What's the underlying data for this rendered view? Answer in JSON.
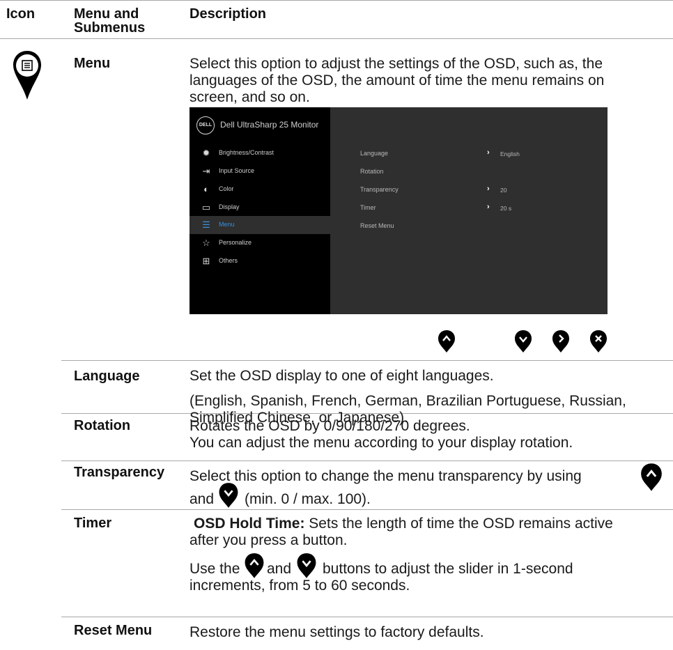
{
  "header": {
    "icon": "Icon",
    "menu_submenus_1": "Menu and",
    "menu_submenus_2": "Submenus",
    "description": "Description"
  },
  "menu_row": {
    "icon": "menu-pin-icon",
    "label": "Menu",
    "description_1": "Select this option to adjust the settings of the OSD, such as, the",
    "description_2": "languages of the OSD, the amount of time the menu remains on",
    "description_3": "screen, and so on."
  },
  "osd": {
    "logo": "DELL",
    "title": "Dell UltraSharp 25 Monitor",
    "left_items": [
      {
        "label": "Brightness/Contrast",
        "icon": "brightness-icon"
      },
      {
        "label": "Input Source",
        "icon": "input-source-icon"
      },
      {
        "label": "Color",
        "icon": "color-icon"
      },
      {
        "label": "Display",
        "icon": "display-icon"
      },
      {
        "label": "Menu",
        "icon": "menu-icon",
        "active": true
      },
      {
        "label": "Personalize",
        "icon": "star-icon"
      },
      {
        "label": "Others",
        "icon": "others-icon"
      }
    ],
    "sub_items": [
      {
        "label": "Language",
        "value": "English",
        "has_arrow": true
      },
      {
        "label": "Rotation",
        "value": "",
        "has_arrow": false
      },
      {
        "label": "Transparency",
        "value": "20",
        "has_arrow": true
      },
      {
        "label": "Timer",
        "value": "20 s",
        "has_arrow": true
      },
      {
        "label": "Reset Menu",
        "value": "",
        "has_arrow": false
      }
    ],
    "nav_buttons": [
      "up-button-icon",
      "down-button-icon",
      "right-button-icon",
      "exit-button-icon"
    ]
  },
  "rows": {
    "language": {
      "label": "Language",
      "line_1": "Set the OSD display to one of eight languages.",
      "line_2": "(English, Spanish, French, German, Brazilian Portuguese, Russian,",
      "line_3": "Simplified Chinese, or Japanese)."
    },
    "rotation": {
      "label": "Rotation",
      "line_1": "Rotates the OSD by 0/90/180/270 degrees.",
      "line_2": "You can adjust the menu according to your display rotation."
    },
    "transparency": {
      "label": "Transparency",
      "line_1": "Select this option to change the menu transparency by using",
      "line_2a": "and",
      "line_2b": "(min. 0 / max. 100)."
    },
    "timer": {
      "label": "Timer",
      "bold": "OSD Hold Time:",
      "line_1": " Sets the length of time the OSD remains active",
      "line_2": "after you press a button.",
      "line_3a": "Use the",
      "line_3b": "and",
      "line_3c": "buttons to adjust the slider in 1-second",
      "line_4": "increments, from 5 to 60 seconds."
    },
    "reset": {
      "label": "Reset Menu",
      "line_1": "Restore the menu settings to factory defaults."
    }
  }
}
